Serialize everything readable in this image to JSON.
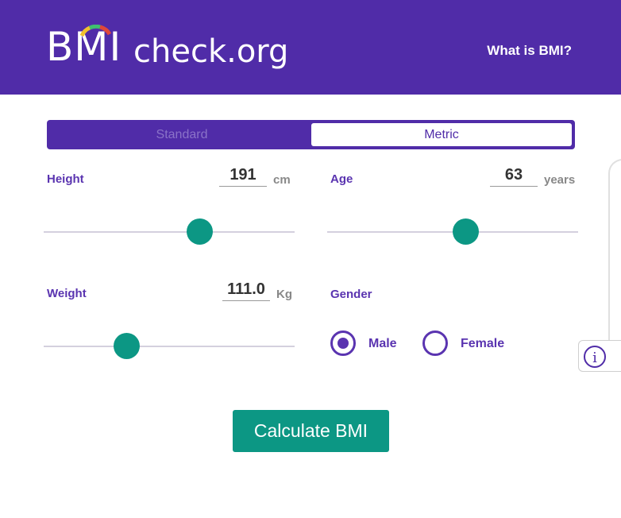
{
  "header": {
    "logo_bmi": "BMI",
    "logo_domain": "check.org",
    "nav_link": "What is BMI?"
  },
  "unit_toggle": {
    "options": [
      "Standard",
      "Metric"
    ],
    "selected": "Metric"
  },
  "height": {
    "label": "Height",
    "value": "191",
    "unit": "cm",
    "slider_fraction": 0.62
  },
  "age": {
    "label": "Age",
    "value": "63",
    "unit": "years",
    "slider_fraction": 0.55
  },
  "weight": {
    "label": "Weight",
    "value": "111.0",
    "unit": "Kg",
    "slider_fraction": 0.33
  },
  "gender": {
    "label": "Gender",
    "options": [
      "Male",
      "Female"
    ],
    "selected": "Male"
  },
  "calculate_button": "Calculate BMI",
  "colors": {
    "brand_purple": "#502ca8",
    "label_purple": "#5a34b0",
    "accent_teal": "#0c9784"
  },
  "icons": {
    "info": "info-icon",
    "gauge": "gauge-icon"
  }
}
